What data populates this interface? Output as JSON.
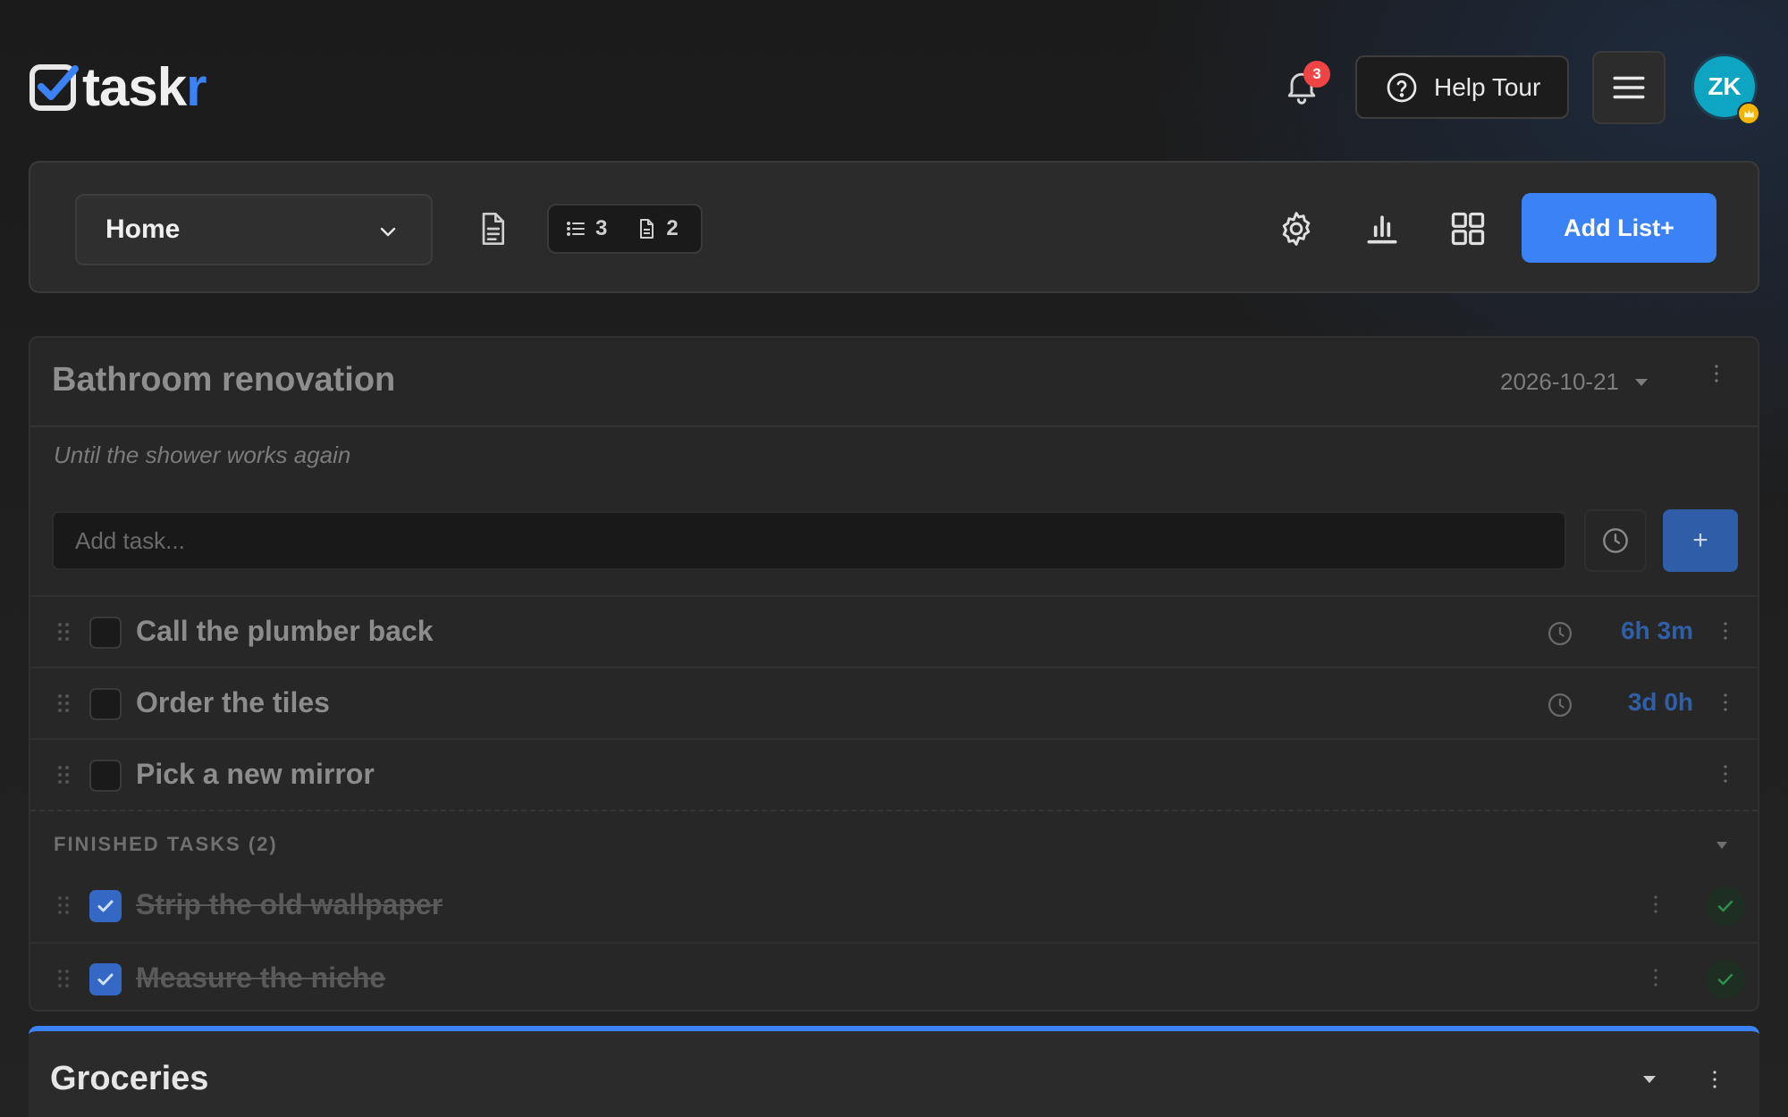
{
  "app": {
    "logo_text_main": "task",
    "logo_text_accent": "r"
  },
  "header": {
    "notification_count": "3",
    "help_label": "Help Tour",
    "avatar_initials": "ZK"
  },
  "toolbar": {
    "board_name": "Home",
    "list_count": "3",
    "note_count": "2",
    "add_list_label": "Add List+"
  },
  "list": {
    "title": "Bathroom renovation",
    "due_date": "2026-10-21",
    "subtitle": "Until the shower works again",
    "add_task_placeholder": "Add task...",
    "add_button": "+",
    "tasks": [
      {
        "text": "Call the plumber back",
        "due": "6h 3m",
        "done": false
      },
      {
        "text": "Order the tiles",
        "due": "3d 0h",
        "done": false
      },
      {
        "text": "Pick a new mirror",
        "due": "",
        "done": false
      }
    ],
    "finished_label": "FINISHED TASKS (2)",
    "finished": [
      {
        "text": "Strip the old wallpaper",
        "done": true
      },
      {
        "text": "Measure the niche",
        "done": true
      }
    ]
  },
  "list2": {
    "title": "Groceries"
  },
  "colors": {
    "accent": "#3b82f6",
    "badge": "#ef4444",
    "avatar": "#0ea5c3",
    "due_text": "#2f5fa8",
    "done_check": "#22c55e"
  },
  "icons": {
    "logo": "checkbox-logo-icon",
    "bell": "bell-icon",
    "help": "question-circle-icon",
    "menu": "hamburger-icon",
    "crown": "crown-icon",
    "document": "document-icon",
    "list": "list-icon",
    "settings": "gear-icon",
    "stats": "bar-chart-icon",
    "grid": "grid-icon",
    "clock": "clock-icon",
    "kebab": "kebab-icon",
    "grip": "drag-handle-icon"
  }
}
